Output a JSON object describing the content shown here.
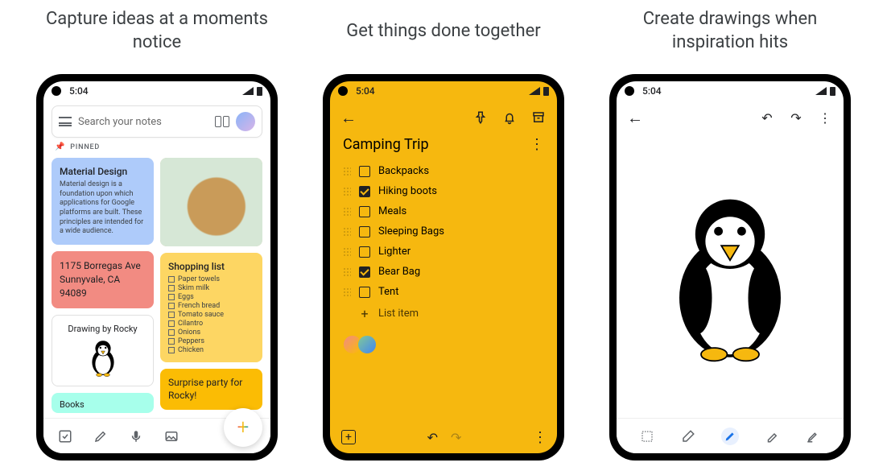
{
  "headlines": {
    "p1": "Capture ideas at a moments notice",
    "p2": "Get things done together",
    "p3": "Create drawings when inspiration hits"
  },
  "status": {
    "time": "5:04"
  },
  "phone1": {
    "search_placeholder": "Search your notes",
    "pinned_label": "PINNED",
    "cards": {
      "material": {
        "title": "Material Design",
        "body": "Material design is a foundation upon which applications for Google platforms are built. These principles are intended for a wide audience."
      },
      "address": "1175 Borregas Ave Sunnyvale, CA 94089",
      "drawing": "Drawing by Rocky",
      "shopping": {
        "title": "Shopping list",
        "items": [
          "Paper towels",
          "Skim milk",
          "Eggs",
          "French bread",
          "Tomato sauce",
          "Cilantro",
          "Onions",
          "Peppers",
          "Chicken"
        ]
      },
      "surprise": "Surprise party for Rocky!",
      "books": "Books"
    }
  },
  "phone2": {
    "title": "Camping Trip",
    "items": [
      {
        "label": "Backpacks",
        "checked": false
      },
      {
        "label": "Hiking boots",
        "checked": true
      },
      {
        "label": "Meals",
        "checked": false
      },
      {
        "label": "Sleeping Bags",
        "checked": false
      },
      {
        "label": "Lighter",
        "checked": false
      },
      {
        "label": "Bear Bag",
        "checked": true
      },
      {
        "label": "Tent",
        "checked": false
      }
    ],
    "add_label": "List item"
  }
}
